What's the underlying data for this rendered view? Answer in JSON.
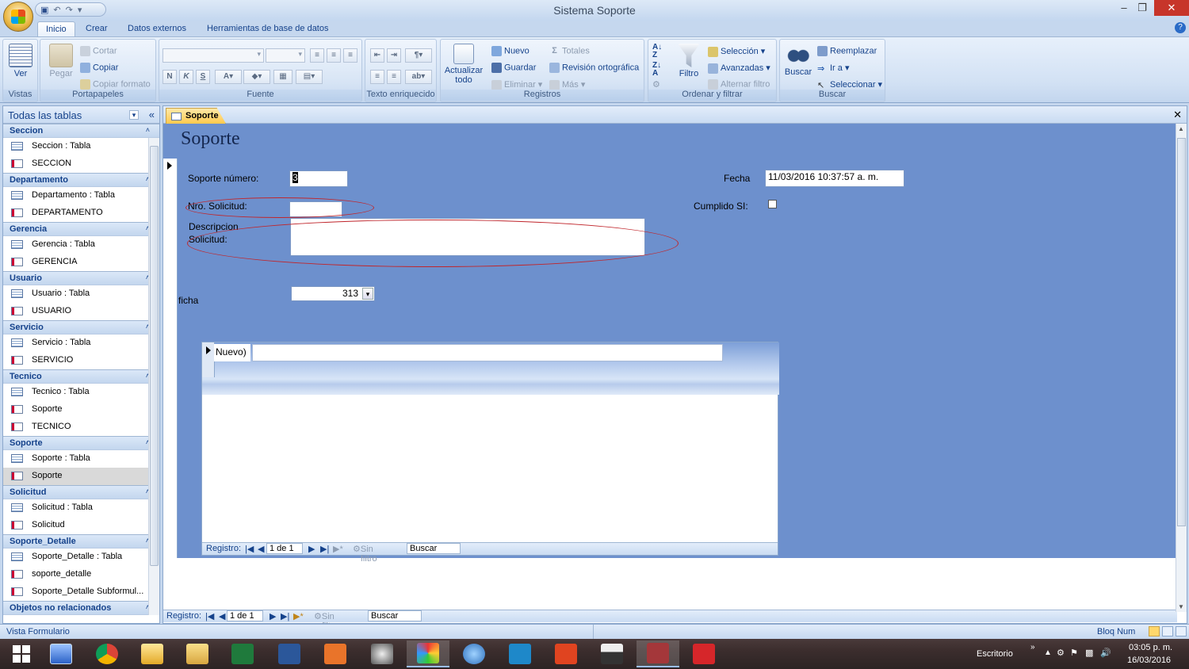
{
  "window": {
    "title": "Sistema Soporte"
  },
  "tabs": [
    {
      "label": "Inicio",
      "active": true
    },
    {
      "label": "Crear"
    },
    {
      "label": "Datos externos"
    },
    {
      "label": "Herramientas de base de datos"
    }
  ],
  "ribbon": {
    "vistas": {
      "label": "Vistas",
      "ver": "Ver"
    },
    "portapapeles": {
      "label": "Portapapeles",
      "pegar": "Pegar",
      "cortar": "Cortar",
      "copiar": "Copiar",
      "copiar_formato": "Copiar formato"
    },
    "fuente": {
      "label": "Fuente",
      "bold": "N",
      "italic": "K",
      "underline": "S"
    },
    "texto": {
      "label": "Texto enriquecido"
    },
    "registros": {
      "label": "Registros",
      "actualizar": "Actualizar todo",
      "nuevo": "Nuevo",
      "guardar": "Guardar",
      "eliminar": "Eliminar",
      "totales": "Totales",
      "revision": "Revisión ortográfica",
      "mas": "Más"
    },
    "ordenar": {
      "label": "Ordenar y filtrar",
      "filtro": "Filtro",
      "seleccion": "Selección",
      "avanzadas": "Avanzadas",
      "alternar": "Alternar filtro"
    },
    "buscar": {
      "label": "Buscar",
      "buscar": "Buscar",
      "reemplazar": "Reemplazar",
      "ira": "Ir a",
      "seleccionar": "Seleccionar"
    }
  },
  "nav": {
    "header": "Todas las tablas",
    "groups": [
      {
        "name": "Seccion",
        "items": [
          "Seccion : Tabla",
          "SECCION"
        ]
      },
      {
        "name": "Departamento",
        "items": [
          "Departamento : Tabla",
          "DEPARTAMENTO"
        ]
      },
      {
        "name": "Gerencia",
        "items": [
          "Gerencia : Tabla",
          "GERENCIA"
        ]
      },
      {
        "name": "Usuario",
        "items": [
          "Usuario : Tabla",
          "USUARIO"
        ]
      },
      {
        "name": "Servicio",
        "items": [
          "Servicio : Tabla",
          "SERVICIO"
        ]
      },
      {
        "name": "Tecnico",
        "items": [
          "Tecnico : Tabla",
          "Soporte",
          "TECNICO"
        ]
      },
      {
        "name": "Soporte",
        "items": [
          "Soporte : Tabla",
          "Soporte"
        ]
      },
      {
        "name": "Solicitud",
        "items": [
          "Solicitud : Tabla",
          "Solicitud"
        ]
      },
      {
        "name": "Soporte_Detalle",
        "items": [
          "Soporte_Detalle : Tabla",
          "soporte_detalle",
          "Soporte_Detalle Subformul..."
        ]
      },
      {
        "name": "Objetos no relacionados",
        "items": []
      }
    ]
  },
  "doc": {
    "tab": "Soporte"
  },
  "form": {
    "title": "Soporte",
    "soporte_numero_label": "Soporte número:",
    "soporte_numero_value": "3",
    "nro_solicitud_label": "Nro. Solicitud:",
    "nro_solicitud_value": "",
    "descripcion_label": "Descripcion Solicitud:",
    "descripcion_value": "",
    "fecha_label": "Fecha",
    "fecha_value": "11/03/2016 10:37:57 a. m.",
    "cumplido_label": "Cumplido SI:",
    "cumplido_checked": false,
    "ficha_label": "ficha",
    "ficha_value": "313",
    "subform_new": "Nuevo)"
  },
  "subnav": {
    "label": "Registro:",
    "position": "1 de 1",
    "filter": "Sin filtro",
    "search": "Buscar"
  },
  "mainnav": {
    "label": "Registro:",
    "position": "1 de 1",
    "filter": "Sin filtro",
    "search": "Buscar"
  },
  "status": {
    "left": "Vista Formulario",
    "right": "Bloq Num"
  },
  "taskbar": {
    "desktop": "Escritorio",
    "time": "03:05 p. m.",
    "date": "16/03/2016"
  },
  "colors": {
    "form_bg": "#6d90cd",
    "accent": "#15428b",
    "close": "#c7352a"
  }
}
